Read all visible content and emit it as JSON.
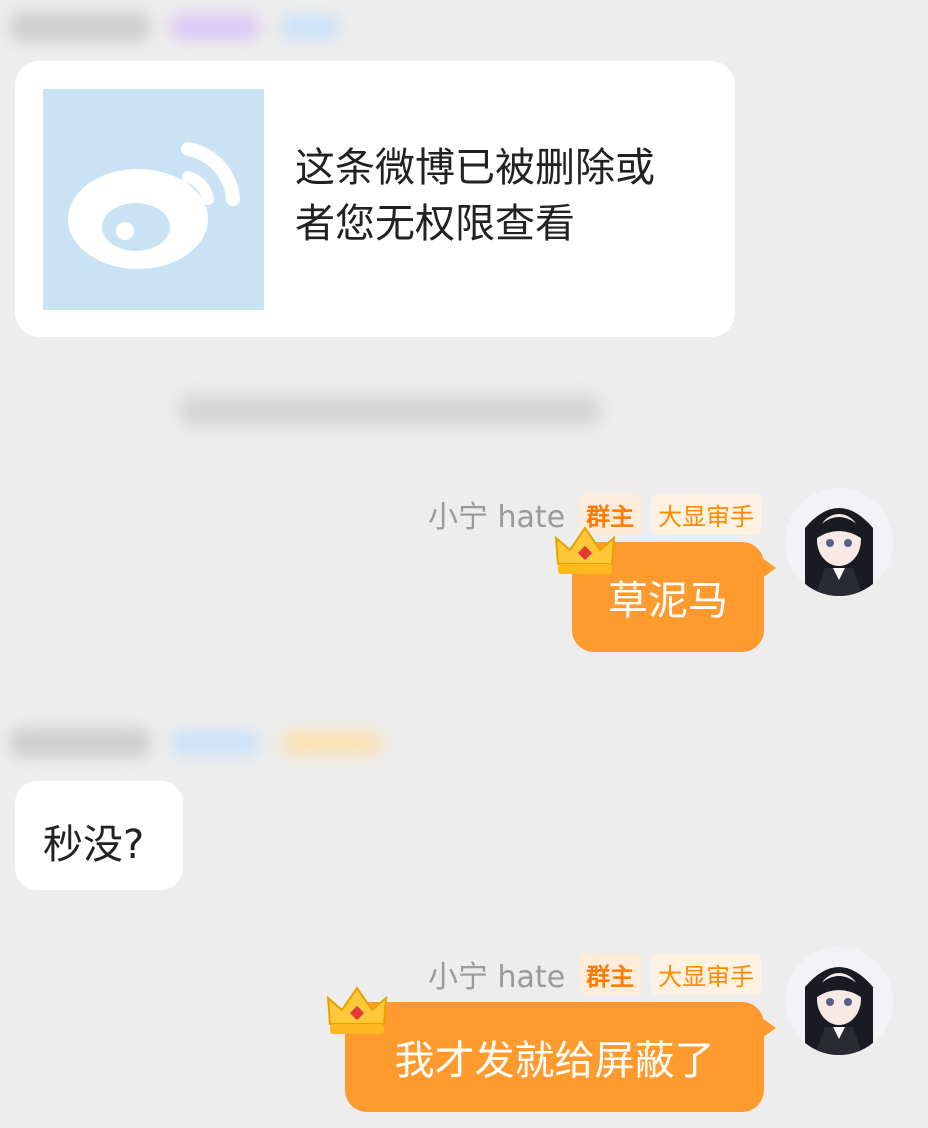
{
  "card": {
    "line1": "这条微博已被删除或",
    "line2": "者您无权限查看",
    "icon": "weibo-logo-icon"
  },
  "messages": [
    {
      "sender": "小宁 hate",
      "role_badge": "群主",
      "title_badge": "大显审手",
      "text": "草泥马"
    },
    {
      "text": "秒没?"
    },
    {
      "sender": "小宁 hate",
      "role_badge": "群主",
      "title_badge": "大显审手",
      "text": "我才发就给屏蔽了"
    }
  ],
  "colors": {
    "background": "#ededed",
    "bubble_self": "#ff9a2e",
    "bubble_other": "#ffffff",
    "badge_text": "#ff7a00"
  }
}
